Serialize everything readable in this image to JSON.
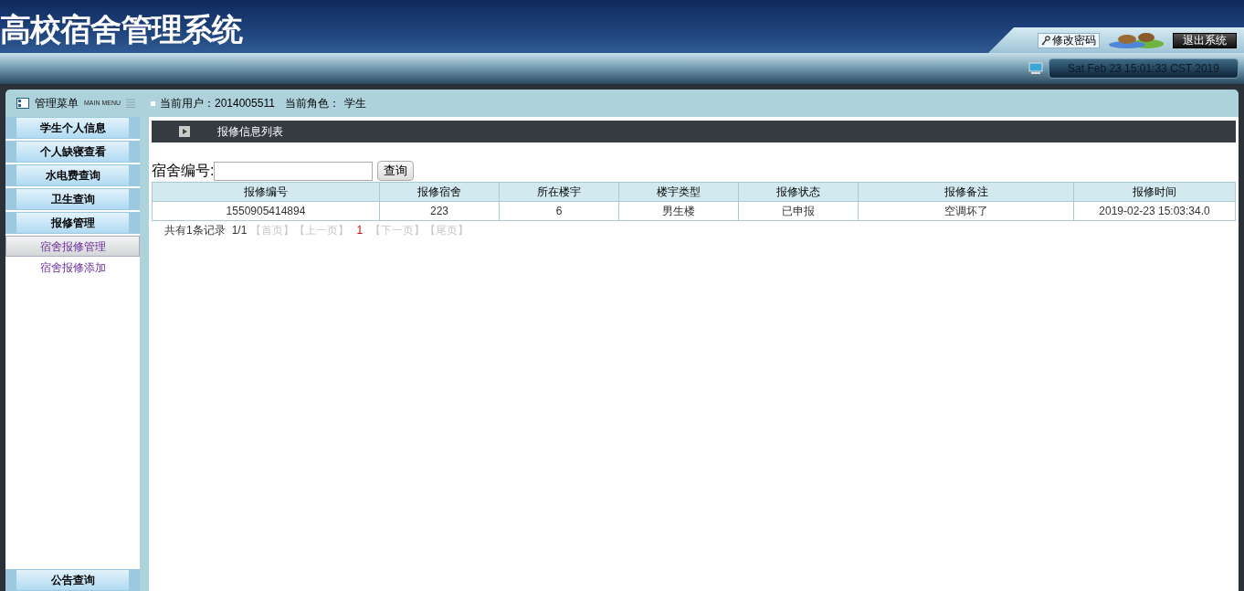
{
  "header": {
    "title": "高校宿舍管理系统",
    "buttons": [
      {
        "kind": "change-password",
        "label": "修改密码"
      },
      {
        "kind": "logout",
        "label": "退出系统"
      }
    ],
    "datetime": "Sat Feb 23 15:01:33 CST 2019"
  },
  "menu_header": {
    "title": "管理菜单",
    "subtitle": "MAIN MENU"
  },
  "user_info": {
    "user_label": "当前用户：",
    "user": "2014005511",
    "role_label": "当前角色：",
    "role": "学生"
  },
  "sidebar": {
    "items": [
      {
        "label": "学生个人信息"
      },
      {
        "label": "个人缺寝查看"
      },
      {
        "label": "水电费查询"
      },
      {
        "label": "卫生查询"
      },
      {
        "label": "报修管理",
        "children": [
          {
            "label": "宿舍报修管理",
            "selected": true
          },
          {
            "label": "宿舍报修添加",
            "selected": false
          }
        ]
      }
    ],
    "bottom_item": {
      "label": "公告查询"
    }
  },
  "panel": {
    "title": "报修信息列表"
  },
  "search": {
    "label": "宿舍编号:",
    "button": "查询"
  },
  "table": {
    "columns": [
      "报修编号",
      "报修宿舍",
      "所在楼宇",
      "楼宇类型",
      "报修状态",
      "报修备注",
      "报修时间"
    ],
    "rows": [
      [
        "1550905414894",
        "223",
        "6",
        "男生楼",
        "已申报",
        "空调坏了",
        "2019-02-23 15:03:34.0"
      ]
    ]
  },
  "pagination": {
    "summary": "共有1条记录",
    "page": "1/1",
    "links": [
      {
        "label": "【首页】",
        "disabled": true
      },
      {
        "label": "【上一页】",
        "disabled": true
      },
      {
        "label": "1",
        "current": true
      },
      {
        "label": "【下一页】",
        "disabled": true
      },
      {
        "label": "【尾页】",
        "disabled": true
      }
    ]
  }
}
